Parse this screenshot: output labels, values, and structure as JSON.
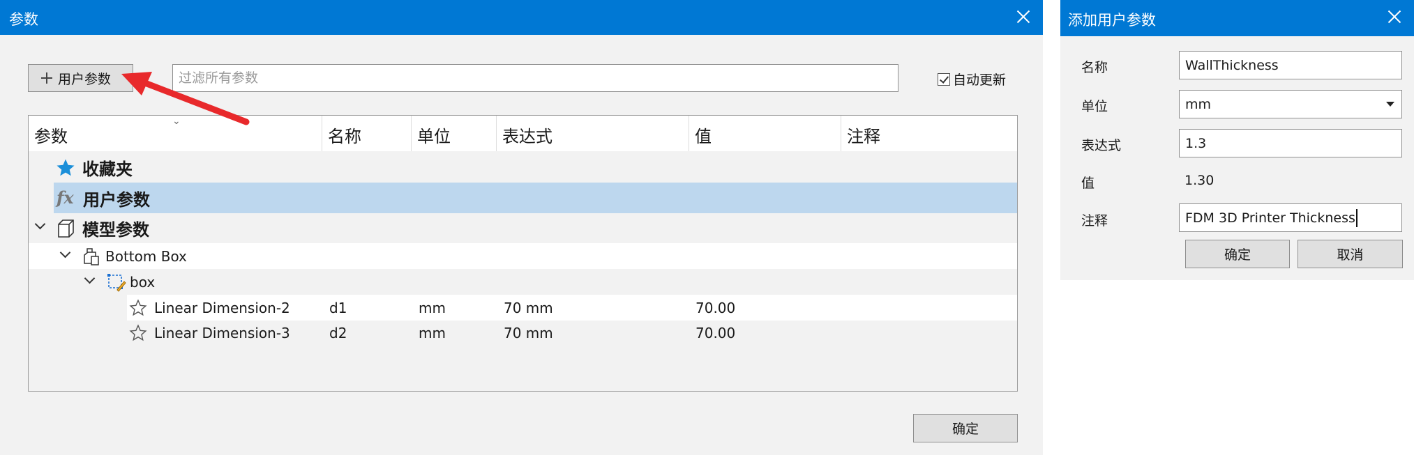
{
  "params_dialog": {
    "title": "参数",
    "user_param_button": "用户参数",
    "filter_placeholder": "过滤所有参数",
    "auto_update_label": "自动更新",
    "ok_button": "确定",
    "columns": [
      "参数",
      "名称",
      "单位",
      "表达式",
      "值",
      "注释"
    ],
    "groups": {
      "favorites": "收藏夹",
      "user_params": "用户参数",
      "model_params": "模型参数"
    },
    "component": "Bottom Box",
    "sketch": "box",
    "rows": [
      {
        "param": "Linear Dimension-2",
        "name": "d1",
        "unit": "mm",
        "expression": "70 mm",
        "value": "70.00",
        "comment": ""
      },
      {
        "param": "Linear Dimension-3",
        "name": "d2",
        "unit": "mm",
        "expression": "70 mm",
        "value": "70.00",
        "comment": ""
      }
    ]
  },
  "add_dialog": {
    "title": "添加用户参数",
    "name_label": "名称",
    "name_value": "WallThickness",
    "unit_label": "单位",
    "unit_value": "mm",
    "expression_label": "表达式",
    "expression_value": "1.3",
    "value_label": "值",
    "value_value": "1.30",
    "comment_label": "注释",
    "comment_value": "FDM 3D Printer Thickness",
    "ok_button": "确定",
    "cancel_button": "取消"
  },
  "colors": {
    "titlebar": "#0078d4",
    "dialog_bg": "#f2f2f2",
    "selected_row": "#bdd7ee",
    "accent_star": "#1b8fd9",
    "annotation_arrow": "#e8292b"
  }
}
